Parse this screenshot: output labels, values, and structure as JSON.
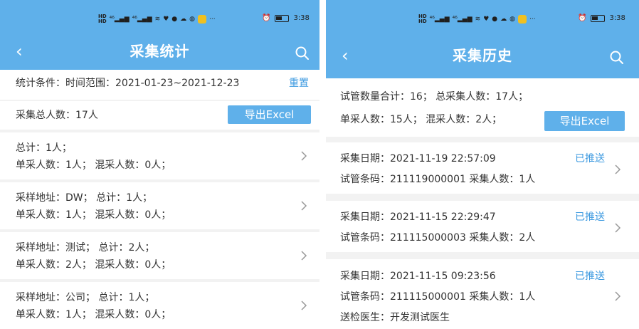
{
  "left": {
    "status": {
      "time": "3:38"
    },
    "header": {
      "back_icon": "chevron-left-icon",
      "title": "采集统计",
      "search_icon": "search-icon"
    },
    "filter": {
      "label": "统计条件：时间范围：2021-01-23~2021-12-23",
      "reset": "重置"
    },
    "summary": {
      "total": "采集总人数：17人",
      "export": "导出Excel"
    },
    "items": [
      {
        "line1": "总计：1人；",
        "line2": "单采人数：1人；  混采人数：0人；"
      },
      {
        "line1": "采样地址：DW；  总计：1人；",
        "line2": "单采人数：1人；  混采人数：0人；"
      },
      {
        "line1": "采样地址：测试；  总计：2人；",
        "line2": "单采人数：2人；  混采人数：0人；"
      },
      {
        "line1": "采样地址：公司；  总计：1人；",
        "line2": "单采人数：1人；  混采人数：0人；"
      }
    ]
  },
  "right": {
    "status": {
      "time": "3:38"
    },
    "header": {
      "back_icon": "chevron-left-icon",
      "title": "采集历史",
      "search_icon": "search-icon"
    },
    "summary": {
      "line1": "试管数量合计：16；  总采集人数：17人；",
      "line2": "单采人数：15人；  混采人数：2人；",
      "export": "导出Excel"
    },
    "records": [
      {
        "date": "采集日期：2021-11-19 22:57:09",
        "tube": "试管条码：211119000001  采集人数：1人",
        "status": "已推送"
      },
      {
        "date": "采集日期：2021-11-15 22:29:47",
        "tube": "试管条码：211115000003  采集人数：2人",
        "status": "已推送"
      },
      {
        "date": "采集日期：2021-11-15 09:23:56",
        "tube": "试管条码：211115000001  采集人数：1人",
        "doctor": "送检医生：开发测试医生",
        "status": "已推送"
      }
    ]
  },
  "theme": {
    "primary": "#5fb0ea",
    "link": "#3d9ae0",
    "background": "#f2f2f2"
  }
}
